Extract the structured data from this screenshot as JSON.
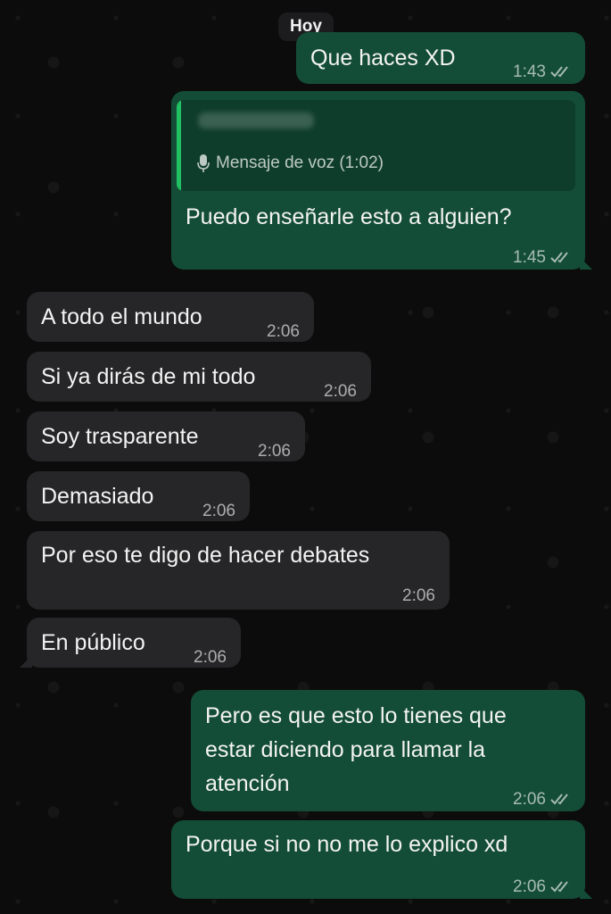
{
  "date_separator": "Hoy",
  "messages": [
    {
      "direction": "out",
      "text": "Que haces XD",
      "time": "1:43",
      "status": "read"
    },
    {
      "direction": "out",
      "text": "Puedo enseñarle esto a alguien?",
      "time": "1:45",
      "status": "read",
      "reply_to": {
        "sender": "",
        "label": "Mensaje de voz (1:02)",
        "icon": "mic-icon"
      }
    },
    {
      "direction": "in",
      "text": "A todo el mundo",
      "time": "2:06"
    },
    {
      "direction": "in",
      "text": "Si ya dirás de mi todo",
      "time": "2:06"
    },
    {
      "direction": "in",
      "text": "Soy trasparente",
      "time": "2:06"
    },
    {
      "direction": "in",
      "text": "Demasiado",
      "time": "2:06"
    },
    {
      "direction": "in",
      "text": "Por eso te digo de hacer debates",
      "time": "2:06"
    },
    {
      "direction": "in",
      "text": "En público",
      "time": "2:06"
    },
    {
      "direction": "out",
      "lines": [
        "Pero es que esto lo tienes que",
        "estar diciendo para llamar la",
        "atención"
      ],
      "time": "2:06",
      "status": "read"
    },
    {
      "direction": "out",
      "text": "Porque si no no me lo explico xd",
      "time": "2:06",
      "status": "read"
    }
  ],
  "colors": {
    "outgoing_bubble": "#144d37",
    "incoming_bubble": "#262628",
    "quote_accent": "#21c063",
    "background": "#0c0c0c"
  }
}
